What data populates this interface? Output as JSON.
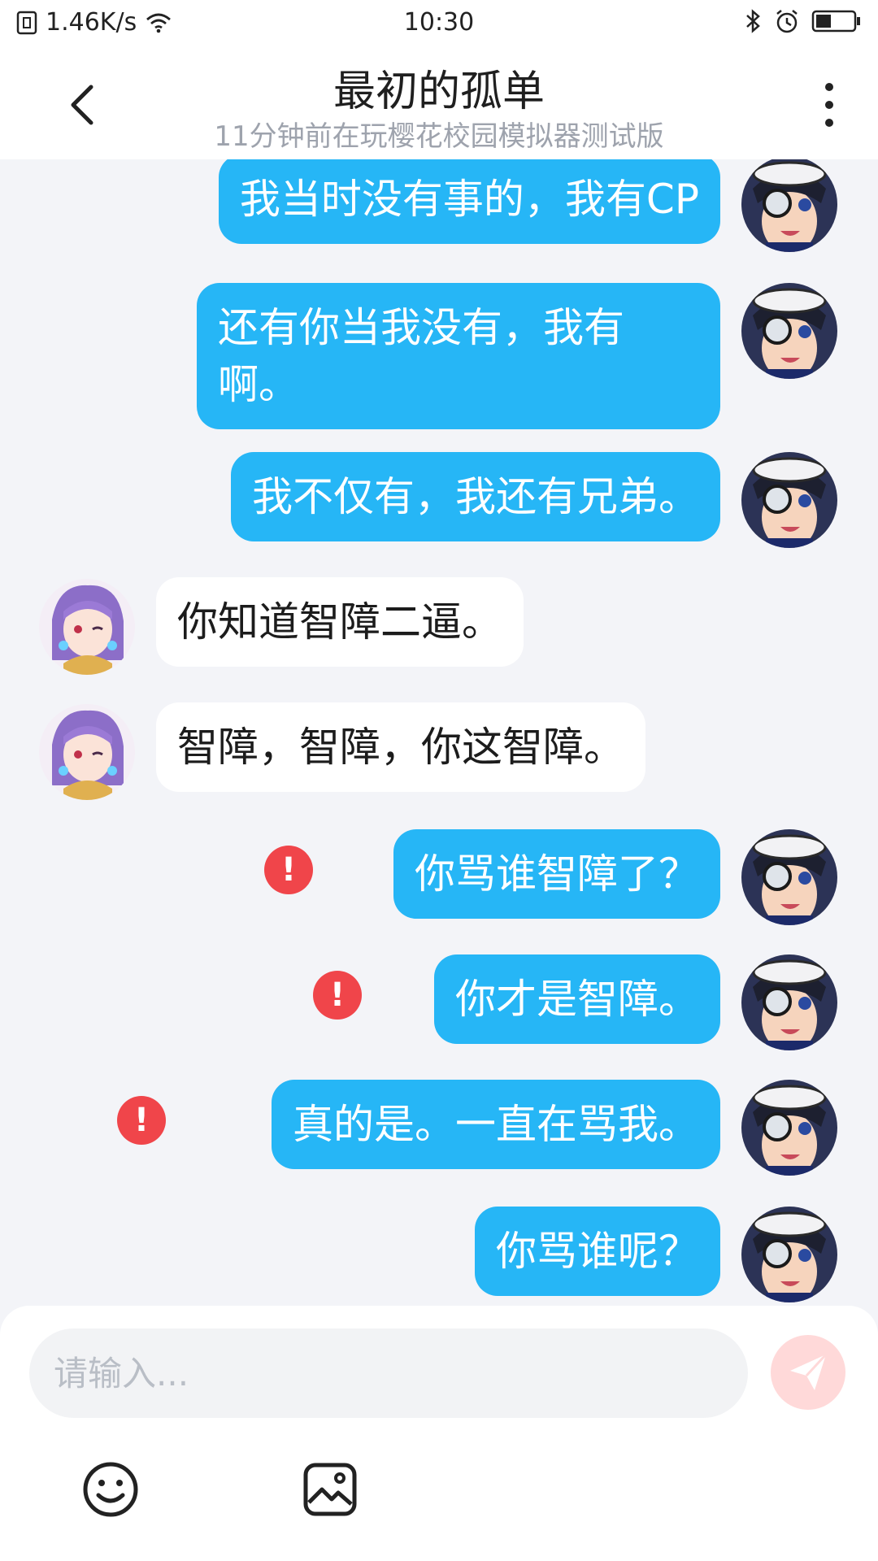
{
  "status_bar": {
    "network_speed": "1.46K/s",
    "time": "10:30"
  },
  "header": {
    "title": "最初的孤单",
    "subtitle": "11分钟前在玩樱花校园模拟器测试版"
  },
  "messages": [
    {
      "direction": "out",
      "text": "我当时没有事的，我有CP",
      "error": false
    },
    {
      "direction": "out",
      "text": "还有你当我没有，我有啊。",
      "error": false
    },
    {
      "direction": "out",
      "text": "我不仅有，我还有兄弟。",
      "error": false
    },
    {
      "direction": "in",
      "text": "你知道智障二逼。",
      "error": false
    },
    {
      "direction": "in",
      "text": "智障，智障，你这智障。",
      "error": false
    },
    {
      "direction": "out",
      "text": "你骂谁智障了？",
      "error": true
    },
    {
      "direction": "out",
      "text": "你才是智障。",
      "error": true
    },
    {
      "direction": "out",
      "text": "真的是。一直在骂我。",
      "error": true
    },
    {
      "direction": "out",
      "text": "你骂谁呢？",
      "error": false
    }
  ],
  "composer": {
    "placeholder": "请输入..."
  },
  "colors": {
    "outgoing_bubble": "#26b6f6",
    "incoming_bubble": "#ffffff",
    "error": "#f0454a",
    "send_button": "#ffd9d9"
  },
  "icons": {
    "back": "chevron-left-icon",
    "more": "more-vertical-icon",
    "error": "exclamation-icon",
    "send": "send-icon",
    "emoji": "emoji-icon",
    "image": "image-icon"
  }
}
